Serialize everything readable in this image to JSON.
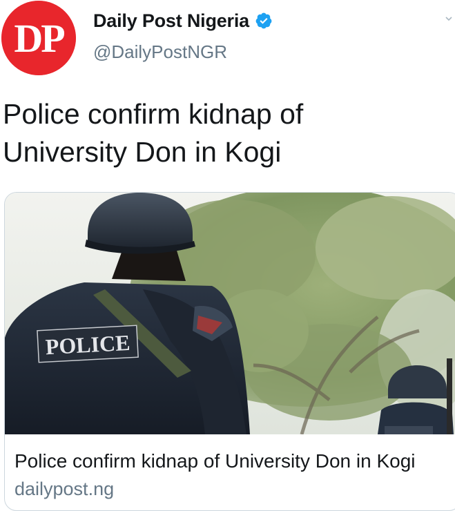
{
  "author": {
    "display_name": "Daily Post Nigeria",
    "handle": "@DailyPostNGR",
    "avatar_text": "DP",
    "avatar_color": "#e8262c",
    "verified": true,
    "verified_icon": "verified-badge-icon",
    "menu_icon": "chevron-down-icon"
  },
  "tweet": {
    "text": "Police confirm kidnap of\nUniversity Don in Kogi"
  },
  "link_card": {
    "image_label": "POLICE",
    "title": "Police confirm kidnap of University Don in Kogi",
    "domain": "dailypost.ng"
  },
  "colors": {
    "verified_blue": "#1da1f2",
    "secondary_text": "#657786",
    "primary_text": "#14171a",
    "card_border": "#ccd6dd"
  }
}
